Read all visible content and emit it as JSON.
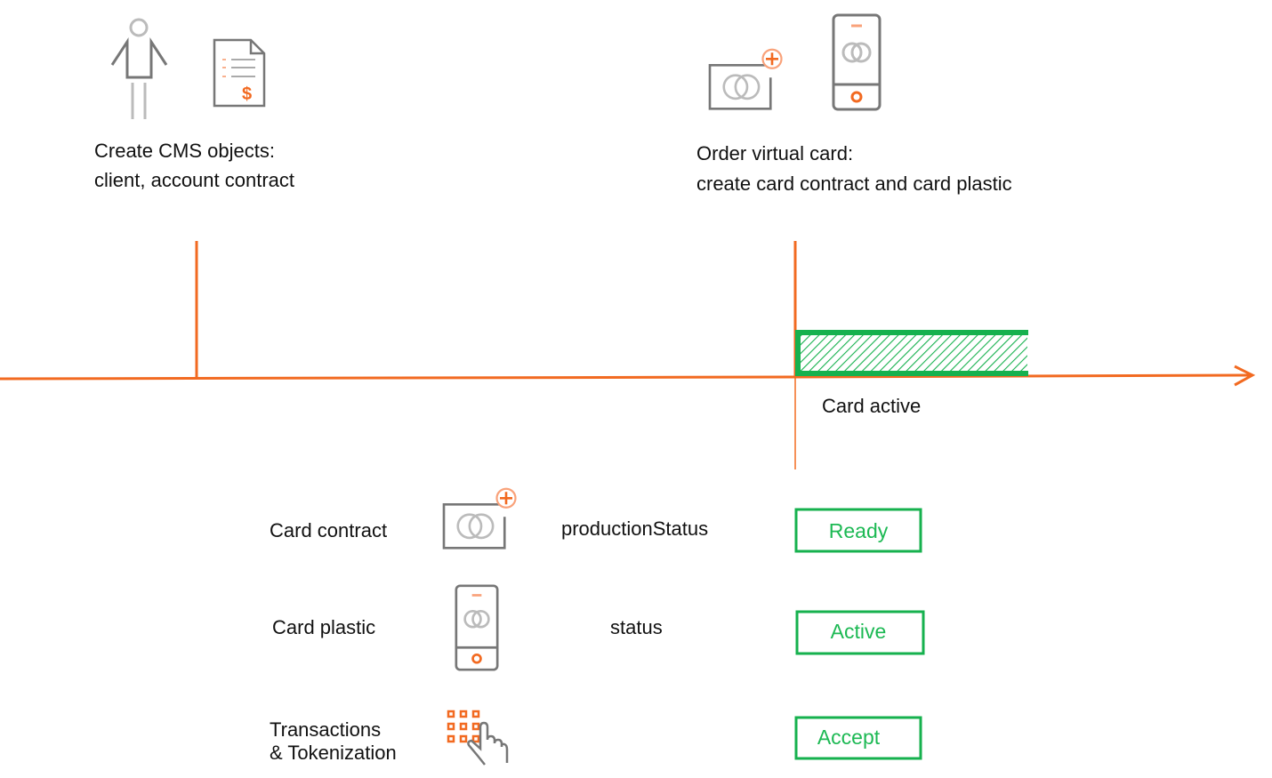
{
  "colors": {
    "timeline": "#f26a21",
    "status": "#16b14e",
    "icon_gray": "#777777",
    "icon_light": "#bbbbbb"
  },
  "top": {
    "step1": {
      "line1": "Create CMS objects:",
      "line2": "client, account contract",
      "icons": [
        "person-icon",
        "invoice-document-icon"
      ]
    },
    "step2": {
      "line1": "Order virtual card:",
      "line2": "create card contract and card plastic",
      "icons": [
        "add-card-icon",
        "mobile-card-icon"
      ]
    }
  },
  "timeline": {
    "period_label": "Card active"
  },
  "rows": [
    {
      "label": "Card contract",
      "icon": "add-card-icon",
      "field": "productionStatus",
      "value": "Ready"
    },
    {
      "label": "Card plastic",
      "icon": "mobile-card-icon",
      "field": "status",
      "value": "Active"
    },
    {
      "label_line1": "Transactions",
      "label_line2": "& Tokenization",
      "icon": "keypad-touch-icon",
      "field": "",
      "value": "Accept"
    }
  ]
}
